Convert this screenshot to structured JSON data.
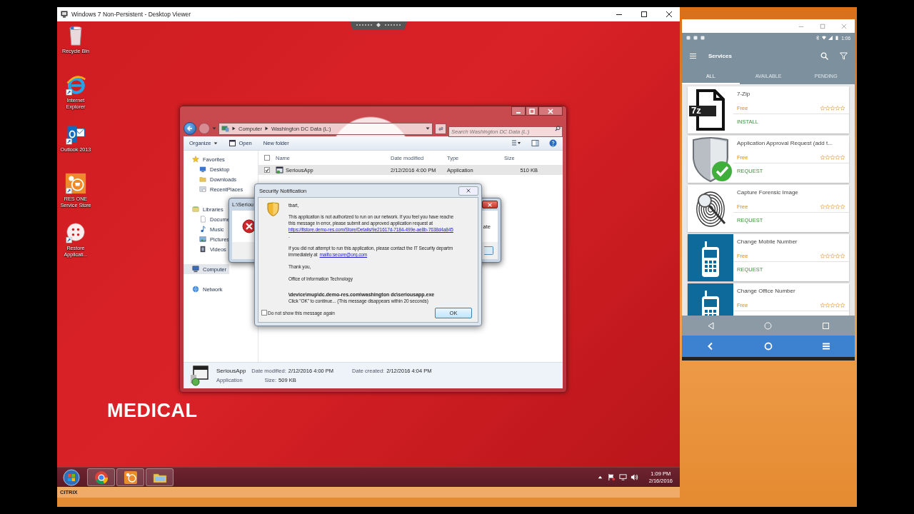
{
  "viewer": {
    "title": "Windows 7 Non-Persistent - Desktop Viewer"
  },
  "desktop": {
    "icons": [
      {
        "kind": "recycle",
        "label": "Recycle Bin"
      },
      {
        "kind": "ie",
        "label": "Internet Explorer"
      },
      {
        "kind": "outlook",
        "label": "Outlook 2013"
      },
      {
        "kind": "store",
        "label": "RES ONE Service Store"
      },
      {
        "kind": "restore",
        "label": "Restore Applicati..."
      }
    ],
    "wallpaper_text": "MEDICAL"
  },
  "explorer": {
    "breadcrumb": [
      "Computer",
      "Washington DC Data (L:)"
    ],
    "search": {
      "placeholder": "Search Washington DC Data (L:)"
    },
    "toolbar": [
      {
        "kind": "menu",
        "label": "Organize"
      },
      {
        "kind": "open",
        "label": "Open"
      },
      {
        "kind": "plain",
        "label": "New folder"
      }
    ],
    "nav": [
      {
        "kind": "favorites",
        "label": "Favorites",
        "selected": false,
        "children": [
          {
            "kind": "desktop",
            "label": "Desktop",
            "selected": false
          },
          {
            "kind": "folder",
            "label": "Downloads",
            "selected": false
          },
          {
            "kind": "recent",
            "label": "RecentPlaces",
            "selected": false
          }
        ]
      },
      {
        "kind": "libraries",
        "label": "Libraries",
        "selected": false,
        "children": [
          {
            "kind": "documents",
            "label": "Docume",
            "selected": false
          },
          {
            "kind": "music",
            "label": "Music",
            "selected": false
          },
          {
            "kind": "pictures",
            "label": "Pictures",
            "selected": false
          },
          {
            "kind": "videos",
            "label": "Videos",
            "selected": false
          }
        ]
      },
      {
        "kind": "computer",
        "label": "Computer",
        "selected": true
      },
      {
        "kind": "network",
        "label": "Network",
        "selected": false
      }
    ],
    "select_all_checked": false,
    "columns": [
      "Name",
      "Date modified",
      "Type",
      "Size"
    ],
    "rows": [
      {
        "name": "SeriousApp",
        "date_modified": "2/12/2016 4:00 PM",
        "type": "Application",
        "size": "510 KB",
        "checked": true,
        "selected": true
      }
    ],
    "details": {
      "name": "SeriousApp",
      "type": "Application",
      "date_modified_label": "Date modified:",
      "date_modified": "2/12/2016 4:00 PM",
      "size_label": "Size:",
      "size": "509 KB",
      "date_created_label": "Date created:",
      "date_created": "2/12/2016 4:04 PM"
    }
  },
  "error_dialog": {
    "title": "L:\\Seriou",
    "text": "ate"
  },
  "security_dialog": {
    "title": "Security Notification",
    "body": [
      {
        "kind": "paragraph",
        "lines": [
          {
            "text": "tbart,"
          }
        ]
      },
      {
        "kind": "paragraph",
        "lines": [
          {
            "text": "This application is not authorized to run on our network.  If you feel you have reache"
          },
          {
            "text": "this message in error, please submit and approved application request at"
          },
          {
            "link": "https://itstore.demo-res.com/Store/Details/9e21617d-7184-499e-ae8b-7638d4a845"
          },
          {
            "text": "."
          }
        ]
      },
      {
        "kind": "paragraph",
        "lines": [
          {
            "text": "If you did not attempt to run this application, please contact the IT Security departm"
          },
          {
            "text": "immediately at",
            "link": "mailto:secure@org.com"
          }
        ]
      },
      {
        "kind": "paragraph",
        "lines": [
          {
            "text": "Thank you,"
          }
        ]
      },
      {
        "kind": "paragraph",
        "lines": [
          {
            "text": "Office of Information Technology"
          }
        ]
      },
      {
        "kind": "path",
        "text": "\\device\\mup\\dc.demo-res.com\\washington dc\\seriousapp.exe"
      },
      {
        "kind": "note",
        "text": "Click \"OK\" to continue... (This message disappears within 20 seconds)"
      }
    ],
    "dont_show_again": {
      "label": "Do not show this message again",
      "checked": false
    },
    "button": "OK"
  },
  "phone": {
    "status_time": "1:06",
    "title": "Services",
    "tabs": [
      {
        "label": "ALL",
        "selected": true
      },
      {
        "label": "AVAILABLE",
        "selected": false
      },
      {
        "label": "PENDING",
        "selected": false
      }
    ],
    "services": [
      {
        "kind": "file",
        "icon_text": "7z",
        "title": "7-Zip",
        "price": "Free",
        "stars": 0,
        "action": "INSTALL"
      },
      {
        "kind": "shield",
        "title": "Application Approval Request (add t...",
        "price": "Free",
        "stars": 0,
        "action": "REQUEST"
      },
      {
        "kind": "fingerprint",
        "title": "Capture Forensic Image",
        "price": "Free",
        "stars": 0,
        "action": "REQUEST"
      },
      {
        "kind": "phone",
        "title": "Change Mobile Number",
        "price": "Free",
        "stars": 0,
        "action": "REQUEST"
      },
      {
        "kind": "phone",
        "title": "Change Office Number",
        "price": "Free",
        "stars": 0
      }
    ]
  },
  "taskbar": {
    "apps": [
      {
        "kind": "chrome"
      },
      {
        "kind": "store"
      },
      {
        "kind": "explorer"
      }
    ],
    "clock": {
      "time": "1:09 PM",
      "date": "2/16/2016"
    }
  },
  "citrix_bar": {
    "logo": "CITRIX"
  }
}
